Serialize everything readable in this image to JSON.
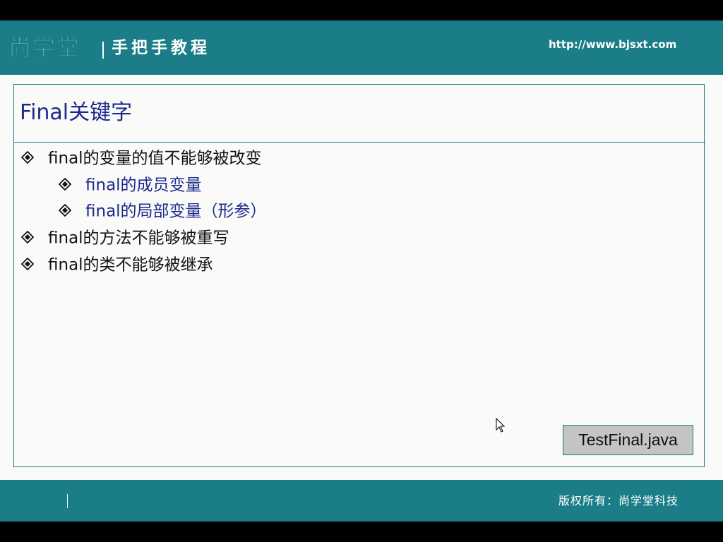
{
  "header": {
    "logo_text": "尚学堂",
    "tagline": "手把手教程",
    "url": "http://www.bjsxt.com"
  },
  "slide": {
    "title": "Final关键字",
    "bullets": [
      {
        "text": "final的变量的值不能够被改变",
        "level": 1
      },
      {
        "text": "final的成员变量",
        "level": 2
      },
      {
        "text": "final的局部变量（形参）",
        "level": 2
      },
      {
        "text": "final的方法不能够被重写",
        "level": 1
      },
      {
        "text": "final的类不能够被继承",
        "level": 1
      }
    ],
    "file_button": "TestFinal.java"
  },
  "footer": {
    "copyright": "版权所有：尚学堂科技"
  },
  "colors": {
    "teal": "#1a7d88",
    "title_blue": "#1c2a8e",
    "background": "#fafaf8"
  },
  "icons": {
    "bullet": "diamond-bullet-icon",
    "cursor": "mouse-pointer-icon"
  }
}
